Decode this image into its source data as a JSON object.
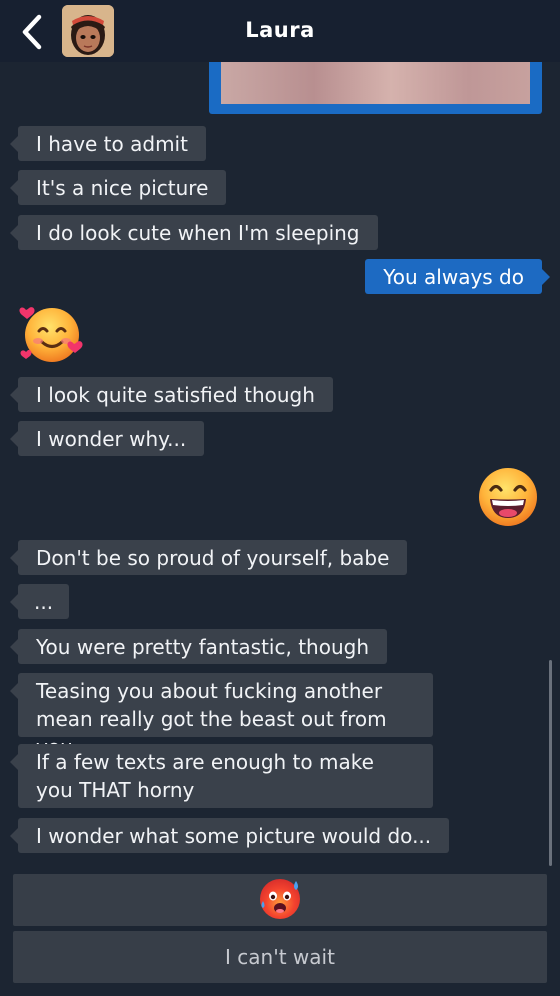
{
  "header": {
    "title": "Laura",
    "back_icon": "chevron-left-icon",
    "avatar": "contact-avatar"
  },
  "messages": [
    {
      "side": "in",
      "text": "I have to admit"
    },
    {
      "side": "in",
      "text": "It's a nice picture"
    },
    {
      "side": "in",
      "text": "I do look cute when I'm sleeping"
    },
    {
      "side": "out",
      "text": "You always do"
    },
    {
      "side": "in",
      "emoji": "smiling-face-with-hearts-icon"
    },
    {
      "side": "in",
      "text": "I look quite satisfied though"
    },
    {
      "side": "in",
      "text": "I wonder why..."
    },
    {
      "side": "out",
      "emoji": "grinning-face-icon"
    },
    {
      "side": "in",
      "text": "Don't be so proud of yourself, babe"
    },
    {
      "side": "in",
      "text": "..."
    },
    {
      "side": "in",
      "text": "You were pretty fantastic, though"
    },
    {
      "side": "in",
      "text": "Teasing you about fucking another mean really got the beast out from you"
    },
    {
      "side": "in",
      "text": "If a few texts are enough to make you THAT horny"
    },
    {
      "side": "in",
      "text": "I wonder what some picture would do..."
    }
  ],
  "choices": [
    {
      "emoji": "hot-face-icon"
    },
    {
      "text": "I can't wait"
    }
  ],
  "colors": {
    "background": "#1c2532",
    "header": "#172030",
    "incoming_bubble": "#3a414b",
    "outgoing_bubble": "#1d6ac2",
    "choice_button": "#373e48"
  }
}
